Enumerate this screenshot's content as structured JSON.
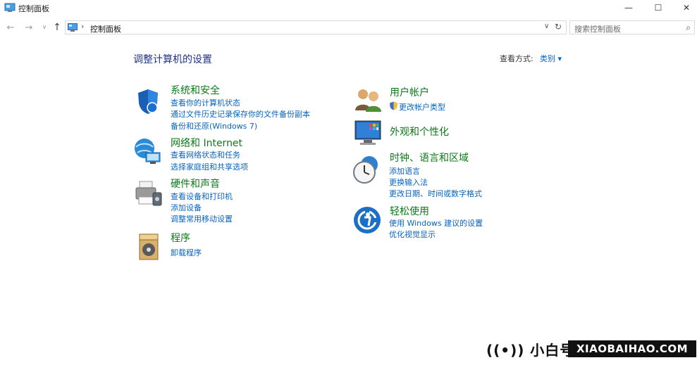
{
  "window": {
    "title": "控制面板",
    "minimize": "—",
    "maximize": "☐",
    "close": "✕"
  },
  "nav": {
    "back": "←",
    "forward": "→",
    "dropdown": "∨",
    "up": "↑",
    "breadcrumb_sep": "›",
    "breadcrumb": "控制面板",
    "address_dropdown": "∨",
    "refresh": "↻",
    "search_placeholder": "搜索控制面板",
    "search_icon": "⌕"
  },
  "main": {
    "title": "调整计算机的设置",
    "view_by_label": "查看方式:",
    "view_by_value": "类别 ▾"
  },
  "categories": [
    {
      "name": "系统和安全",
      "icon": "shield-icon",
      "links": [
        "查看你的计算机状态",
        "通过文件历史记录保存你的文件备份副本",
        "备份和还原(Windows 7)"
      ]
    },
    {
      "name": "网络和 Internet",
      "icon": "network-icon",
      "links": [
        "查看网络状态和任务",
        "选择家庭组和共享选项"
      ]
    },
    {
      "name": "硬件和声音",
      "icon": "printer-icon",
      "links": [
        "查看设备和打印机",
        "添加设备",
        "调整常用移动设置"
      ]
    },
    {
      "name": "程序",
      "icon": "programs-icon",
      "links": [
        "卸载程序"
      ]
    },
    {
      "name": "用户帐户",
      "icon": "users-icon",
      "links": [
        "更改帐户类型"
      ]
    },
    {
      "name": "外观和个性化",
      "icon": "appearance-icon",
      "links": []
    },
    {
      "name": "时钟、语言和区域",
      "icon": "clock-icon",
      "links": [
        "添加语言",
        "更换输入法",
        "更改日期、时间或数字格式"
      ]
    },
    {
      "name": "轻松使用",
      "icon": "ease-of-access-icon",
      "links": [
        "使用 Windows 建议的设置",
        "优化视觉显示"
      ]
    }
  ],
  "watermark": {
    "logo_text": "((•)) 小白号",
    "brand": "XIAOBAIHAO.COM"
  }
}
